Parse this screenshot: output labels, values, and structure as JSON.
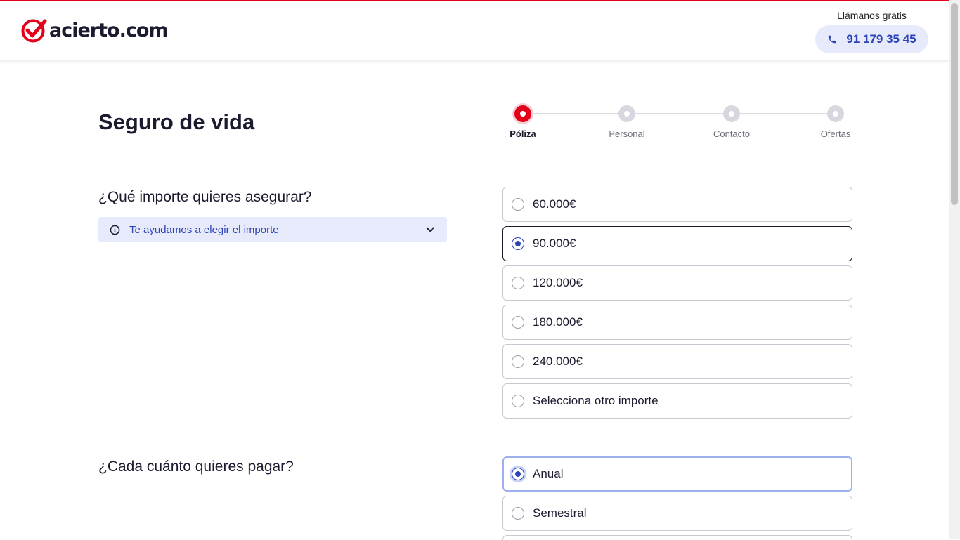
{
  "header": {
    "brand": "acierto.com",
    "call_label": "Llámanos gratis",
    "phone": "91 179 35 45"
  },
  "page": {
    "title": "Seguro de vida"
  },
  "stepper": {
    "steps": [
      {
        "label": "Póliza",
        "active": true
      },
      {
        "label": "Personal",
        "active": false
      },
      {
        "label": "Contacto",
        "active": false
      },
      {
        "label": "Ofertas",
        "active": false
      }
    ]
  },
  "amount_question": {
    "title": "¿Qué importe quieres asegurar?",
    "help": "Te ayudamos a elegir el importe",
    "options": [
      "60.000€",
      "90.000€",
      "120.000€",
      "180.000€",
      "240.000€",
      "Selecciona otro importe"
    ],
    "selected": "90.000€"
  },
  "frequency_question": {
    "title": "¿Cada cuánto quieres pagar?",
    "options": [
      "Anual",
      "Semestral"
    ],
    "selected": "Anual"
  },
  "colors": {
    "brand_red": "#e3001b",
    "accent_blue": "#2d44b8",
    "light_blue_bg": "#e7eafb"
  }
}
